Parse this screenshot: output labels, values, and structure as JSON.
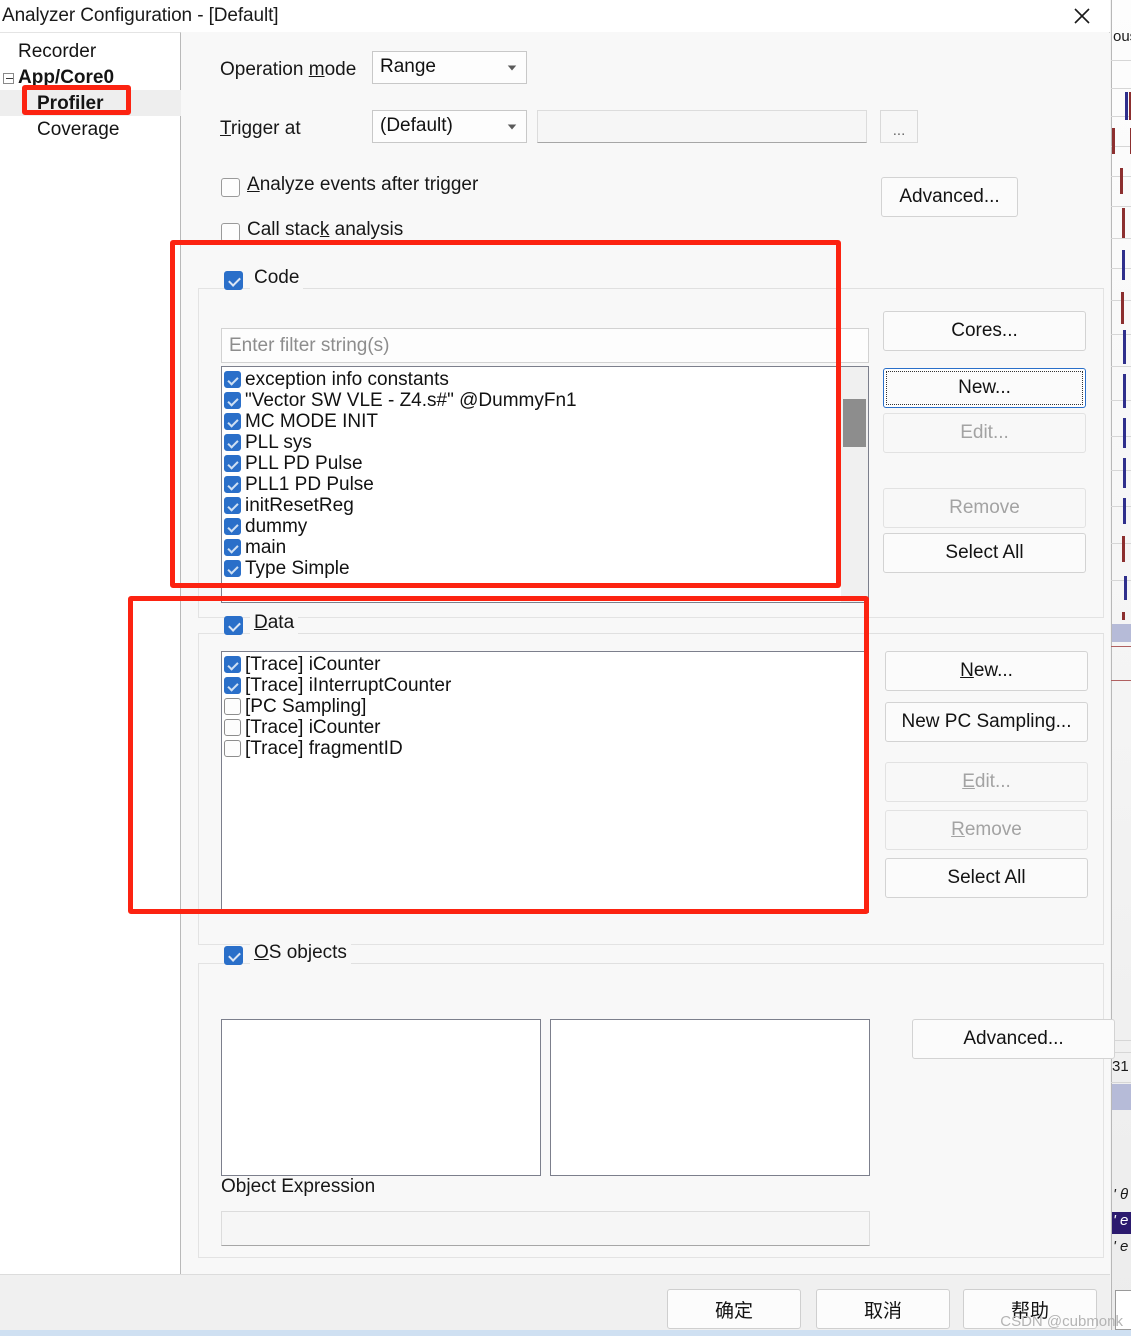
{
  "window": {
    "title": "Analyzer Configuration - [Default]",
    "close_icon": "close-icon"
  },
  "sidebar": {
    "items": [
      {
        "label": "Recorder",
        "bold": false,
        "selected": false,
        "indent": 18,
        "expander": false
      },
      {
        "label": "App/Core0",
        "bold": true,
        "selected": false,
        "indent": 18,
        "expander": true
      },
      {
        "label": "Profiler",
        "bold": true,
        "selected": true,
        "indent": 37,
        "expander": false
      },
      {
        "label": "Coverage",
        "bold": false,
        "selected": false,
        "indent": 37,
        "expander": false
      }
    ]
  },
  "form": {
    "operation_mode_label": "Operation mode",
    "operation_mode_value": "Range",
    "trigger_at_label": "Trigger at",
    "trigger_at_value": "(Default)",
    "trigger_expression": "",
    "browse_label": "...",
    "analyze_events_label": "Analyze events after trigger",
    "analyze_events_checked": false,
    "call_stack_label": "Call stack analysis",
    "call_stack_checked": false,
    "advanced_top_label": "Advanced..."
  },
  "code_section": {
    "title": "Code",
    "checked": true,
    "filter_placeholder": "Enter filter string(s)",
    "filter_value": "",
    "items": [
      {
        "label": "  exception  info  constants",
        "checked": true
      },
      {
        "label": "\"Vector  SW  VLE - Z4.s#\"  @DummyFn1",
        "checked": true
      },
      {
        "label": "MC  MODE  INIT",
        "checked": true
      },
      {
        "label": "PLL  sys",
        "checked": true
      },
      {
        "label": "PLL  PD  Pulse",
        "checked": true
      },
      {
        "label": "PLL1  PD  Pulse",
        "checked": true
      },
      {
        "label": "initResetReg",
        "checked": true
      },
      {
        "label": "dummy",
        "checked": true
      },
      {
        "label": "main",
        "checked": true
      },
      {
        "label": "Type  Simple",
        "checked": true
      }
    ],
    "buttons": [
      {
        "label": "Cores...",
        "state": "normal"
      },
      {
        "label": "New...",
        "state": "focused"
      },
      {
        "label": "Edit...",
        "state": "disabled"
      },
      {
        "label": "Remove",
        "state": "disabled"
      },
      {
        "label": "Select All",
        "state": "normal"
      }
    ]
  },
  "data_section": {
    "title": "Data",
    "checked": true,
    "items": [
      {
        "label": "[Trace] iCounter",
        "checked": true
      },
      {
        "label": "[Trace] iInterruptCounter",
        "checked": true
      },
      {
        "label": "[PC Sampling]",
        "checked": false
      },
      {
        "label": "[Trace] iCounter",
        "checked": false
      },
      {
        "label": "[Trace] fragmentID",
        "checked": false
      }
    ],
    "buttons": [
      {
        "label": "New...",
        "state": "normal"
      },
      {
        "label": "New PC Sampling...",
        "state": "normal"
      },
      {
        "label": "Edit...",
        "state": "disabled"
      },
      {
        "label": "Remove",
        "state": "disabled"
      },
      {
        "label": "Select All",
        "state": "normal"
      }
    ]
  },
  "os_section": {
    "title": "OS objects",
    "checked": true,
    "advanced_label": "Advanced...",
    "object_expression_label": "Object Expression",
    "object_expression_value": ""
  },
  "dialog_buttons": {
    "ok": "确定",
    "cancel": "取消",
    "help": "帮助"
  },
  "watermark": "CSDN @cubmonk",
  "background_strip": {
    "fragment_top": "ous",
    "fragment_number": "31",
    "fragment_a": "' θ",
    "fragment_b": "' e",
    "fragment_c": "' e"
  },
  "colors": {
    "accent_blue": "#2a6fc9",
    "annotation_red": "#fc2311",
    "selected_row": "#eeeeee",
    "dialog_bg": "#f8f8f8"
  }
}
